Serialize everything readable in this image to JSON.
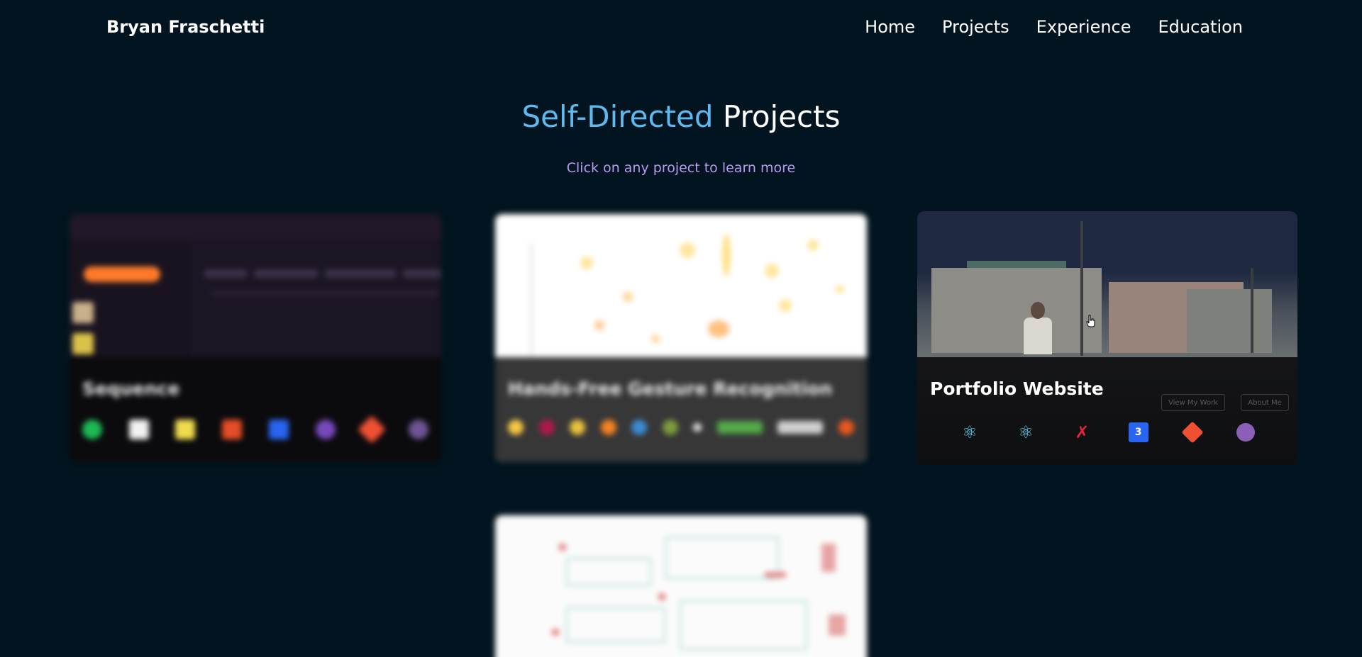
{
  "nav": {
    "brand": "Bryan Fraschetti",
    "links": [
      "Home",
      "Projects",
      "Experience",
      "Education"
    ]
  },
  "header": {
    "title_accent": "Self-Directed",
    "title_rest": "Projects",
    "subtitle": "Click on any project to learn more"
  },
  "colors": {
    "background": "#02141f",
    "accent": "#5fb9ee",
    "subtitle": "#b79af0"
  },
  "projects": [
    {
      "title": "Sequence",
      "blurred": true,
      "tech_icons": [
        "spotify-icon",
        "gcp-icon",
        "js-icon",
        "html5-icon",
        "css3-icon",
        "redux-icon",
        "git-icon",
        "github-icon"
      ]
    },
    {
      "title": "Hands-Free Gesture Recognition",
      "blurred": true,
      "tech_icons": [
        "python-icon",
        "jupyter-icon",
        "python-notebook-icon",
        "tensorflow-icon",
        "sklearn-icon",
        "matplotlib-icon",
        "numpy-icon",
        "pandas-icon",
        "keras-icon",
        "git-icon"
      ]
    },
    {
      "title": "Portfolio Website",
      "blurred": false,
      "ghost_buttons": [
        "View My Work",
        "About Me"
      ],
      "tech_icons": [
        "react-icon",
        "react-bootstrap-icon",
        "framer-motion-icon",
        "css3-icon",
        "git-icon",
        "github-icon"
      ]
    },
    {
      "title": "",
      "blurred": true,
      "tech_icons": []
    }
  ]
}
